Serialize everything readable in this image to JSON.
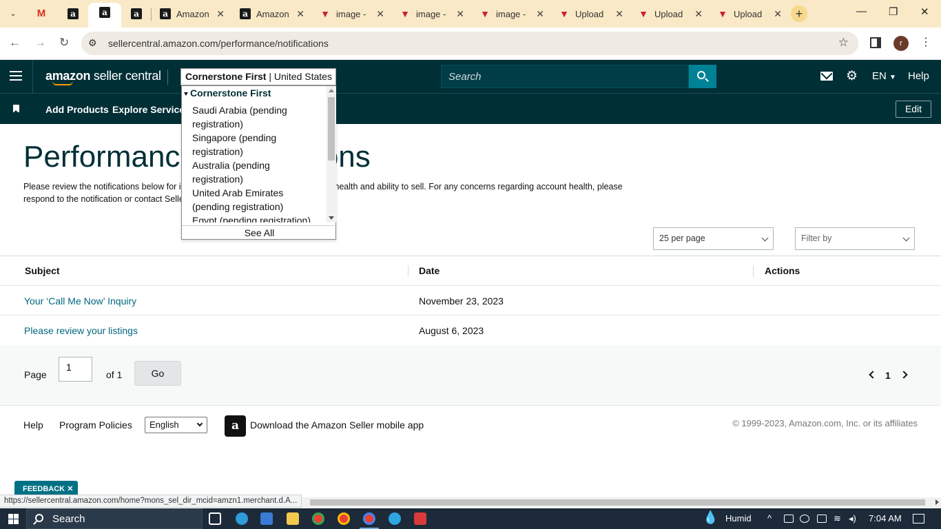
{
  "browser": {
    "tabs": [
      {
        "label": "",
        "icon": "gmail-icon"
      },
      {
        "label": "",
        "icon": "amazon-icon"
      },
      {
        "label": "",
        "icon": "amazon-icon",
        "active": true
      },
      {
        "label": "",
        "icon": "amazon-icon"
      },
      {
        "label": "Amazon",
        "icon": "amazon-icon"
      },
      {
        "label": "Amazon",
        "icon": "amazon-icon"
      },
      {
        "label": "image -",
        "icon": "red-arrow-icon"
      },
      {
        "label": "image -",
        "icon": "red-arrow-icon"
      },
      {
        "label": "image -",
        "icon": "red-arrow-icon"
      },
      {
        "label": "Upload",
        "icon": "red-arrow-icon"
      },
      {
        "label": "Upload",
        "icon": "red-arrow-icon"
      },
      {
        "label": "Upload",
        "icon": "red-arrow-icon"
      }
    ],
    "url": "sellercentral.amazon.com/performance/notifications",
    "profile_initial": "r",
    "status_url": "https://sellercentral.amazon.com/home?mons_sel_dir_mcid=amzn1.merchant.d.A..."
  },
  "header": {
    "logo_bold": "amazon",
    "logo_rest": " seller central",
    "account_name": "Cornerstone First",
    "account_sep": " | ",
    "account_region": "United States",
    "search_placeholder": "Search",
    "language": "EN",
    "help": "Help"
  },
  "account_dropdown": {
    "group": "Cornerstone First",
    "items": [
      "Saudi Arabia (pending registration)",
      "Singapore (pending registration)",
      "Australia (pending registration)",
      "United Arab Emirates (pending registration)",
      "Egypt (pending registration)"
    ],
    "see_all": "See All"
  },
  "subnav": {
    "links": [
      "Add Products",
      "Explore Services"
    ],
    "edit": "Edit"
  },
  "page": {
    "title": "Performance Notifications",
    "description": "Please review the notifications below for information that may affect your account health and ability to sell. For any concerns regarding account health, please respond to the notification or contact Seller Support.",
    "per_page": "25 per page",
    "filter": "Filter by"
  },
  "table": {
    "headers": [
      "Subject",
      "Date",
      "Actions"
    ],
    "rows": [
      {
        "subject": "Your ‘Call Me Now’ Inquiry",
        "date": "November 23, 2023",
        "actions": ""
      },
      {
        "subject": "Please review your listings",
        "date": "August 6, 2023",
        "actions": ""
      }
    ]
  },
  "pagination": {
    "page_label": "Page",
    "page_value": "1",
    "of_label": "of 1",
    "go": "Go",
    "current": "1"
  },
  "footer": {
    "help": "Help",
    "program_policies": "Program Policies",
    "language": "English",
    "app_text": "Download the Amazon Seller mobile app",
    "copyright": "© 1999-2023, Amazon.com, Inc. or its affiliates"
  },
  "feedback": "FEEDBACK",
  "taskbar": {
    "search": "Search",
    "weather": "Humid",
    "time": "7:04 AM"
  }
}
